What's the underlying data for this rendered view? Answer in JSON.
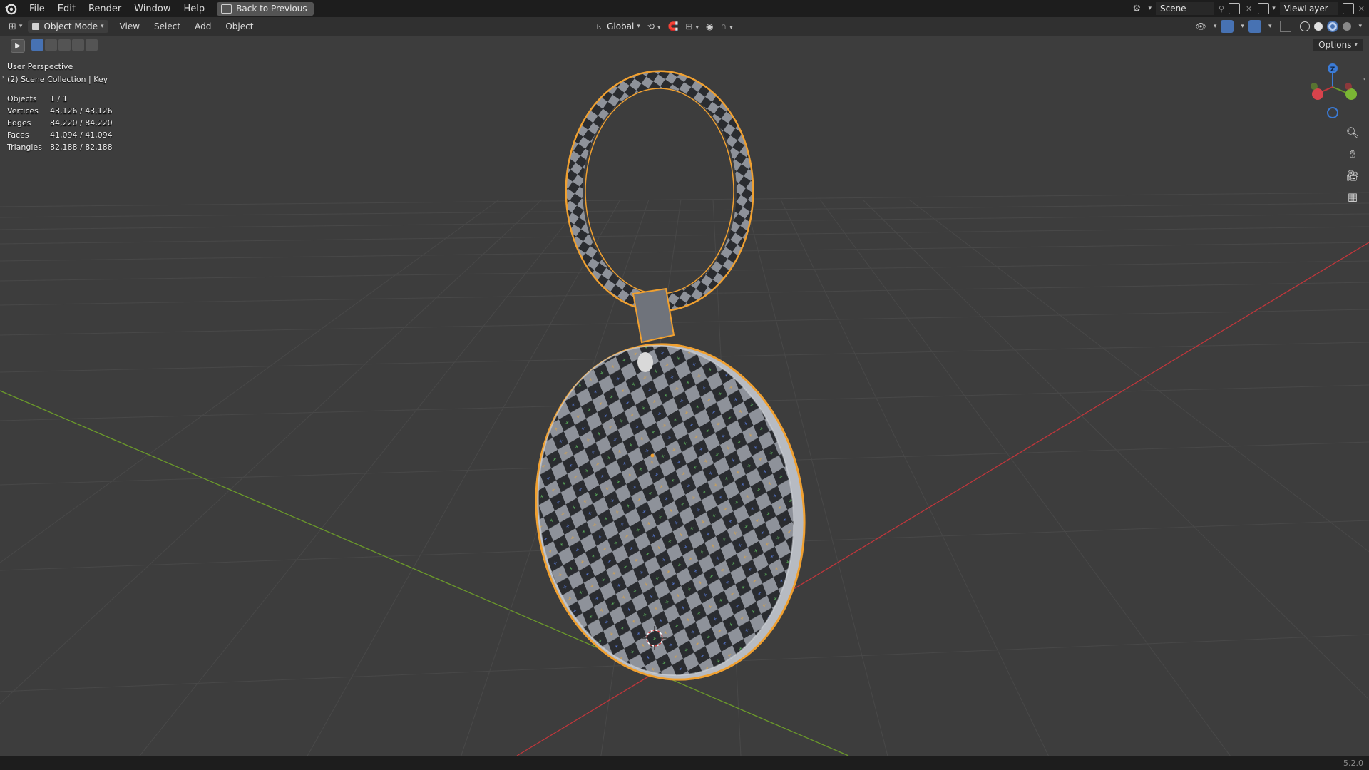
{
  "menu": {
    "items": [
      "File",
      "Edit",
      "Render",
      "Window",
      "Help"
    ],
    "back_button": "Back to Previous"
  },
  "top_right": {
    "scene_label": "Scene",
    "view_layer_label": "ViewLayer"
  },
  "header": {
    "mode": "Object Mode",
    "menus": [
      "View",
      "Select",
      "Add",
      "Object"
    ],
    "transform_orientation": "Global",
    "options_label": "Options"
  },
  "viewport": {
    "perspective": "User Perspective",
    "collection": "(2) Scene Collection | Key",
    "stats": [
      {
        "label": "Objects",
        "value": "1 / 1"
      },
      {
        "label": "Vertices",
        "value": "43,126 / 43,126"
      },
      {
        "label": "Edges",
        "value": "84,220 / 84,220"
      },
      {
        "label": "Faces",
        "value": "41,094 / 41,094"
      },
      {
        "label": "Triangles",
        "value": "82,188 / 82,188"
      }
    ],
    "gizmo_axis_label": "Z"
  },
  "status": {
    "version": "5.2.0"
  },
  "colors": {
    "selection_outline": "#f0a030",
    "x_axis": "#c0363b",
    "y_axis": "#6b9a2a",
    "z_axis": "#3b7bd6",
    "checker_dark": "#2a2c30",
    "checker_light": "#8e929a"
  }
}
